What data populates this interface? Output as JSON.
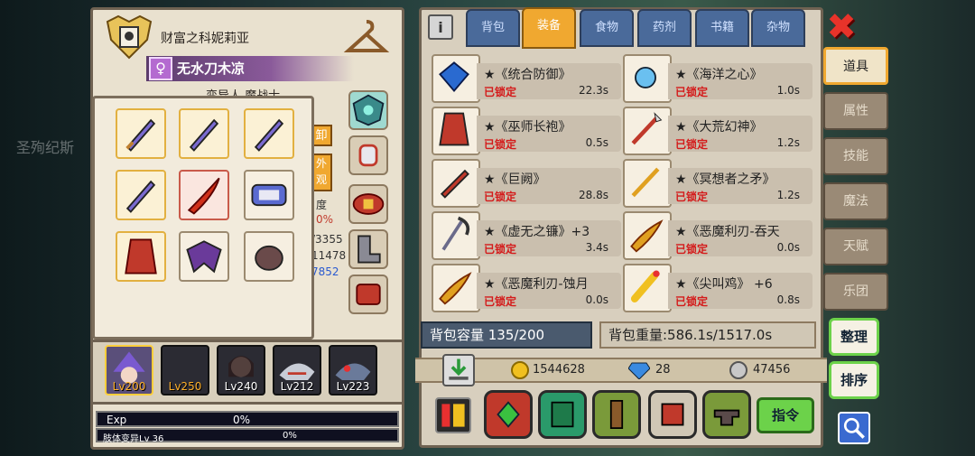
{
  "character": {
    "title": "财富之科妮莉亚",
    "name": "无水刀木凉",
    "gender_symbol": "♀",
    "class_label": "变异人 魔战士",
    "side_buttons": [
      "卸",
      "外观"
    ],
    "partial_stats": [
      "度",
      "0%",
      "/3355",
      "11478",
      "7852"
    ]
  },
  "party": [
    {
      "level": "Lv200",
      "selected": true
    },
    {
      "level": "Lv250",
      "selected": false
    },
    {
      "level": "Lv240",
      "selected": false
    },
    {
      "level": "Lv212",
      "selected": false
    },
    {
      "level": "Lv223",
      "selected": false
    }
  ],
  "exp": {
    "label": "Exp",
    "value": "0%",
    "sub_label": "肢体变异Lv 36",
    "sub_value": "0%"
  },
  "tabs": [
    "背包",
    "装备",
    "食物",
    "药剂",
    "书籍",
    "杂物"
  ],
  "active_tab": "装备",
  "items": [
    {
      "name": "★《统合防御》",
      "lock": "已锁定",
      "time": "22.3s"
    },
    {
      "name": "★《海洋之心》",
      "lock": "已锁定",
      "time": "1.0s"
    },
    {
      "name": "★《巫师长袍》",
      "lock": "已锁定",
      "time": "0.5s"
    },
    {
      "name": "★《大荒幻神》",
      "lock": "已锁定",
      "time": "1.2s"
    },
    {
      "name": "★《巨阙》",
      "lock": "已锁定",
      "time": "28.8s"
    },
    {
      "name": "★《冥想者之矛》",
      "lock": "已锁定",
      "time": "1.2s"
    },
    {
      "name": "★《虚无之镰》+3",
      "lock": "已锁定",
      "time": "3.4s"
    },
    {
      "name": "★《恶魔利刃-吞天",
      "lock": "已锁定",
      "time": "0.0s"
    },
    {
      "name": "★《恶魔利刃-蚀月",
      "lock": "已锁定",
      "time": "0.0s"
    },
    {
      "name": "★《尖叫鸡》 +6",
      "lock": "已锁定",
      "time": "0.8s"
    }
  ],
  "capacity": "背包容量 135/200",
  "weight": "背包重量:586.1s/1517.0s",
  "currency": {
    "gold": "1544628",
    "diamond": "28",
    "silver": "47456"
  },
  "command_button": "指令",
  "side_tabs": [
    "道具",
    "属性",
    "技能",
    "魔法",
    "天赋",
    "乐团"
  ],
  "active_side_tab": "道具",
  "side_actions": [
    "整理",
    "排序"
  ],
  "colors": {
    "accent": "#f0a830",
    "lock_red": "#d41b1b",
    "green_button": "#6cd24a"
  }
}
